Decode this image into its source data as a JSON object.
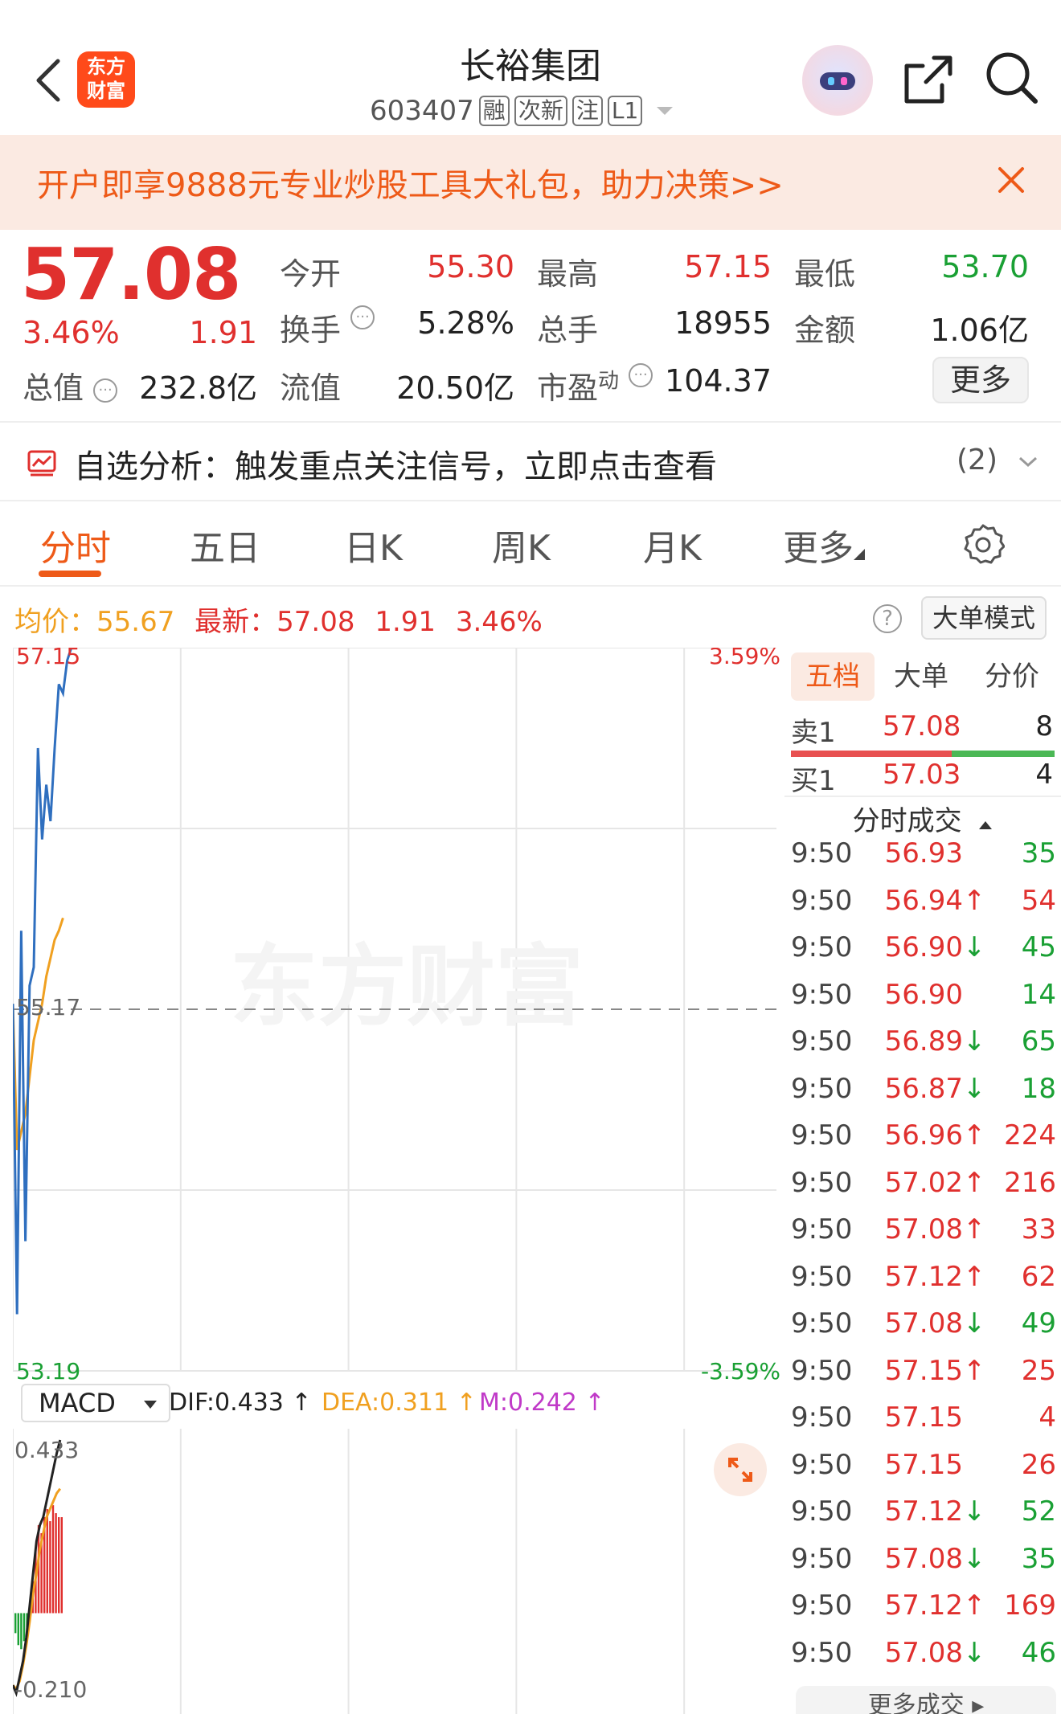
{
  "header": {
    "logo_text": "东方财富",
    "stock_name": "长裕集团",
    "stock_code": "603407",
    "tags": [
      "融",
      "次新",
      "注",
      "L1"
    ]
  },
  "banner": {
    "text": "开户即享9888元专业炒股工具大礼包，助力决策>>"
  },
  "quote": {
    "price": "57.08",
    "change_pct": "3.46%",
    "change_amt": "1.91",
    "open_label": "今开",
    "open": "55.30",
    "high_label": "最高",
    "high": "57.15",
    "low_label": "最低",
    "low": "53.70",
    "turnover_label": "换手",
    "turnover": "5.28%",
    "volume_label": "总手",
    "volume": "18955",
    "amount_label": "金额",
    "amount": "1.06亿",
    "mktcap_label": "总值",
    "mktcap": "232.8亿",
    "float_label": "流值",
    "float": "20.50亿",
    "pe_label": "市盈",
    "pe_sup": "动",
    "pe": "104.37",
    "more": "更多"
  },
  "analysis": {
    "text": "自选分析：触发重点关注信号，立即点击查看",
    "count": "(2)"
  },
  "tabs": [
    "分时",
    "五日",
    "日K",
    "周K",
    "月K",
    "更多"
  ],
  "chart_info": {
    "avg_label": "均价：",
    "avg": "55.67",
    "latest_label": "最新：",
    "latest": "57.08",
    "change_amt": "1.91",
    "change_pct": "3.46%",
    "help": "?",
    "big_order_mode": "大单模式"
  },
  "chart_data": {
    "type": "line",
    "y_top_label": "57.15",
    "y_mid_label": "55.17",
    "y_bottom_label": "53.19",
    "pct_top_label": "3.59%",
    "pct_bottom_label": "-3.59%",
    "ylim": [
      53.19,
      57.15
    ],
    "watermark": "东方财富",
    "series": [
      {
        "values": [
          55.2,
          53.5,
          55.6,
          53.9,
          55.3,
          55.4,
          56.6,
          56.1,
          56.4,
          56.2,
          56.6,
          56.95,
          56.9,
          57.08,
          57.15
        ]
      },
      {
        "values": [
          55.2,
          54.4,
          54.5,
          54.6,
          54.8,
          55.0,
          55.1,
          55.2,
          55.35,
          55.45,
          55.55,
          55.6,
          55.67
        ]
      }
    ],
    "colors": {
      "price": "#2f6fbf",
      "avg": "#f0a020",
      "up": "#e0302e",
      "down": "#1aa034"
    }
  },
  "macd": {
    "selector": "MACD",
    "dif": "DIF:0.433",
    "dea": "DEA:0.311",
    "m": "M:0.242",
    "y_top_label": "0.433",
    "y_bottom_label": "-0.210",
    "hist": [
      -0.05,
      -0.08,
      -0.09,
      -0.07,
      -0.04,
      0.02,
      0.08,
      0.16,
      0.22,
      0.2,
      0.24,
      0.26,
      0.23,
      0.27,
      0.25,
      0.24,
      0.24
    ],
    "dif_line": [
      -0.18,
      -0.2,
      -0.16,
      -0.12,
      -0.06,
      0.02,
      0.1,
      0.18,
      0.22,
      0.24,
      0.28,
      0.32,
      0.36,
      0.4,
      0.433
    ],
    "dea_line": [
      -0.18,
      -0.19,
      -0.17,
      -0.13,
      -0.08,
      -0.02,
      0.05,
      0.1,
      0.16,
      0.2,
      0.24,
      0.26,
      0.28,
      0.3,
      0.311
    ]
  },
  "orderbook": {
    "tabs": [
      "五档",
      "大单",
      "分价"
    ],
    "sell1": {
      "label": "卖1",
      "price": "57.08",
      "vol": "8"
    },
    "buy1": {
      "label": "买1",
      "price": "57.03",
      "vol": "4"
    },
    "ticks_title": "分时成交",
    "ticks": [
      {
        "time": "9:50",
        "price": "56.93",
        "vol": "35",
        "dir": "",
        "pc": "red",
        "vc": "green"
      },
      {
        "time": "9:50",
        "price": "56.94",
        "vol": "54",
        "dir": "↑",
        "pc": "red",
        "vc": "red"
      },
      {
        "time": "9:50",
        "price": "56.90",
        "vol": "45",
        "dir": "↓",
        "pc": "red",
        "vc": "green"
      },
      {
        "time": "9:50",
        "price": "56.90",
        "vol": "14",
        "dir": "",
        "pc": "red",
        "vc": "green"
      },
      {
        "time": "9:50",
        "price": "56.89",
        "vol": "65",
        "dir": "↓",
        "pc": "red",
        "vc": "green"
      },
      {
        "time": "9:50",
        "price": "56.87",
        "vol": "18",
        "dir": "↓",
        "pc": "red",
        "vc": "green"
      },
      {
        "time": "9:50",
        "price": "56.96",
        "vol": "224",
        "dir": "↑",
        "pc": "red",
        "vc": "red"
      },
      {
        "time": "9:50",
        "price": "57.02",
        "vol": "216",
        "dir": "↑",
        "pc": "red",
        "vc": "red"
      },
      {
        "time": "9:50",
        "price": "57.08",
        "vol": "33",
        "dir": "↑",
        "pc": "red",
        "vc": "red"
      },
      {
        "time": "9:50",
        "price": "57.12",
        "vol": "62",
        "dir": "↑",
        "pc": "red",
        "vc": "red"
      },
      {
        "time": "9:50",
        "price": "57.08",
        "vol": "49",
        "dir": "↓",
        "pc": "red",
        "vc": "green"
      },
      {
        "time": "9:50",
        "price": "57.15",
        "vol": "25",
        "dir": "↑",
        "pc": "red",
        "vc": "red"
      },
      {
        "time": "9:50",
        "price": "57.15",
        "vol": "4",
        "dir": "",
        "pc": "red",
        "vc": "red"
      },
      {
        "time": "9:50",
        "price": "57.15",
        "vol": "26",
        "dir": "",
        "pc": "red",
        "vc": "red"
      },
      {
        "time": "9:50",
        "price": "57.12",
        "vol": "52",
        "dir": "↓",
        "pc": "red",
        "vc": "green"
      },
      {
        "time": "9:50",
        "price": "57.08",
        "vol": "35",
        "dir": "↓",
        "pc": "red",
        "vc": "green"
      },
      {
        "time": "9:50",
        "price": "57.12",
        "vol": "169",
        "dir": "↑",
        "pc": "red",
        "vc": "red"
      },
      {
        "time": "9:50",
        "price": "57.08",
        "vol": "46",
        "dir": "↓",
        "pc": "red",
        "vc": "green"
      }
    ],
    "more_trades": "更多成交"
  }
}
